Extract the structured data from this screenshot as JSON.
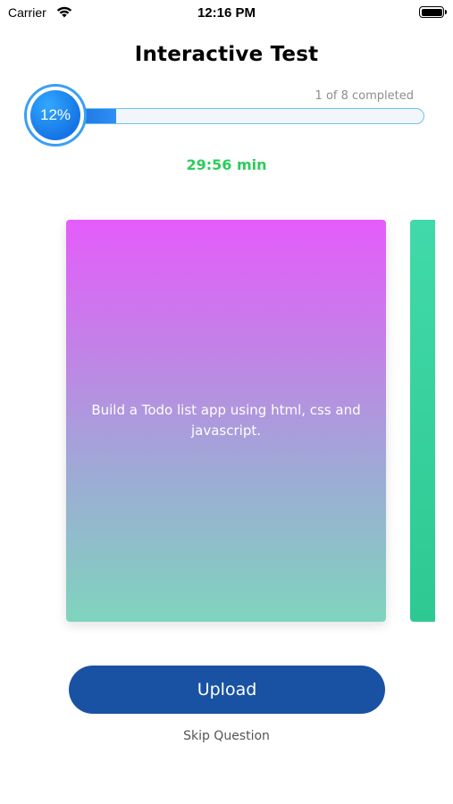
{
  "status_bar": {
    "carrier": "Carrier",
    "time": "12:16 PM",
    "icons": [
      "wifi-icon",
      "battery-icon"
    ]
  },
  "header": {
    "title": "Interactive Test"
  },
  "progress": {
    "percent_label": "12%",
    "fraction": 0.12,
    "caption": "1 of 8 completed",
    "accent_color": "#2f8ef5"
  },
  "timer": {
    "text": "29:56 min",
    "color": "#2ecc5b"
  },
  "card": {
    "question": "Build a Todo list app using html, css and javascript.",
    "gradient_colors": [
      "#e55cfb",
      "#9fa9d6",
      "#7fd4bd"
    ]
  },
  "next_card": {
    "color": "#41d9a9"
  },
  "actions": {
    "upload_label": "Upload",
    "upload_color": "#1a52a3",
    "skip_label": "Skip Question"
  }
}
